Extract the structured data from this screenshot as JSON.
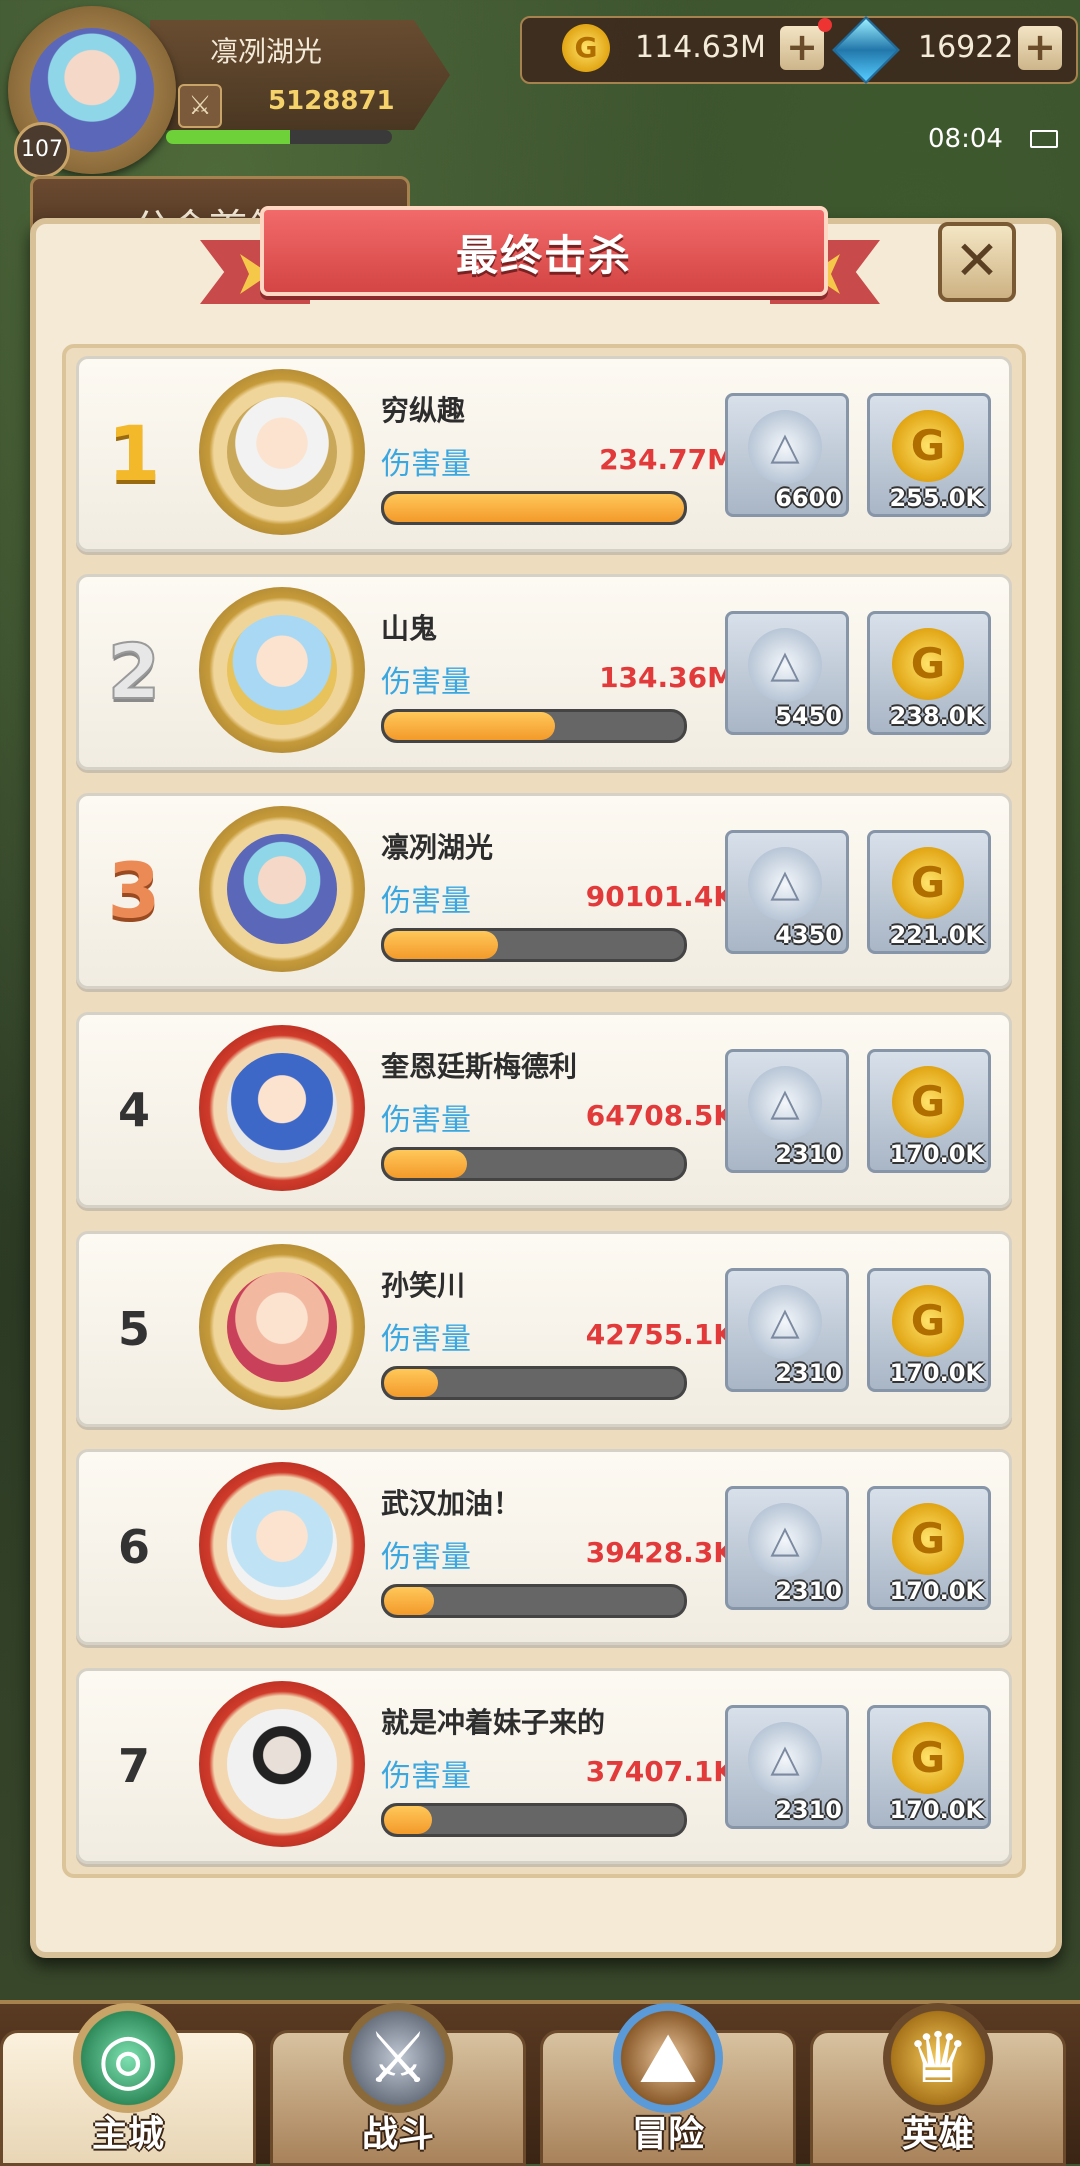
{
  "player": {
    "name": "凛冽湖光",
    "level": "107",
    "power": "5128871",
    "exp_fraction": 0.55
  },
  "resources": {
    "gold": "114.63M",
    "gems": "16922",
    "plus": "+"
  },
  "status": {
    "time": "08:04"
  },
  "guild_tab": {
    "label": "公会首领"
  },
  "dialog": {
    "title": "最终击杀",
    "close": "✕"
  },
  "labels": {
    "damage": "伤害量"
  },
  "leaderboard": [
    {
      "rank": "1",
      "name": "穷纵趣",
      "damage": "234.77M",
      "fraction": 1.0,
      "silver": "6600",
      "gold": "255.0K"
    },
    {
      "rank": "2",
      "name": "山鬼",
      "damage": "134.36M",
      "fraction": 0.57,
      "silver": "5450",
      "gold": "238.0K"
    },
    {
      "rank": "3",
      "name": "凛冽湖光",
      "damage": "90101.4K",
      "fraction": 0.38,
      "silver": "4350",
      "gold": "221.0K"
    },
    {
      "rank": "4",
      "name": "奎恩廷斯梅德利",
      "damage": "64708.5K",
      "fraction": 0.275,
      "silver": "2310",
      "gold": "170.0K"
    },
    {
      "rank": "5",
      "name": "孙笑川",
      "damage": "42755.1K",
      "fraction": 0.18,
      "silver": "2310",
      "gold": "170.0K"
    },
    {
      "rank": "6",
      "name": "武汉加油！",
      "damage": "39428.3K",
      "fraction": 0.168,
      "silver": "2310",
      "gold": "170.0K"
    },
    {
      "rank": "7",
      "name": "就是冲着妹子来的",
      "damage": "37407.1K",
      "fraction": 0.16,
      "silver": "2310",
      "gold": "170.0K"
    }
  ],
  "nav": [
    {
      "label": "主城",
      "icon": "main-city-icon"
    },
    {
      "label": "战斗",
      "icon": "crossed-swords-icon"
    },
    {
      "label": "冒险",
      "icon": "adventure-map-icon"
    },
    {
      "label": "英雄",
      "icon": "hero-shield-icon"
    }
  ]
}
